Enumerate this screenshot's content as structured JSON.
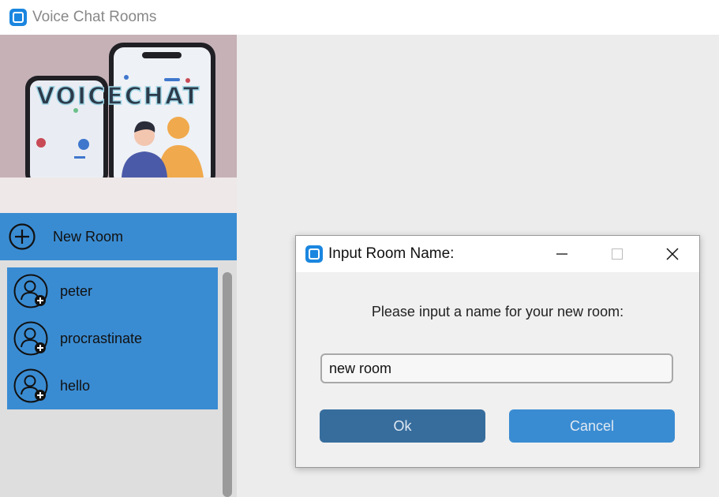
{
  "window": {
    "title": "Voice Chat Rooms",
    "icon": "app-icon"
  },
  "sidebar": {
    "banner_text": "VOICECHAT",
    "new_room_label": "New Room",
    "rooms": [
      {
        "name": "peter"
      },
      {
        "name": "procrastinate"
      },
      {
        "name": "hello"
      }
    ]
  },
  "dialog": {
    "title": "Input Room Name:",
    "prompt": "Please input a name for your new room:",
    "input_value": "new room",
    "ok_label": "Ok",
    "cancel_label": "Cancel"
  },
  "colors": {
    "accent": "#3a8cd2",
    "ok_button": "#376d9d",
    "sidebar_bg": "#dedede",
    "main_bg": "#ececec"
  }
}
